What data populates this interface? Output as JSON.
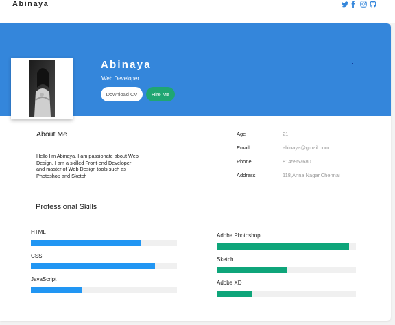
{
  "header": {
    "brand": "Abinaya",
    "social_icons": [
      "twitter-icon",
      "facebook-icon",
      "instagram-icon",
      "github-icon"
    ]
  },
  "profile": {
    "name": "Abinaya",
    "role": "Web Developer",
    "download_cv_label": "Download CV",
    "hire_me_label": "Hire Me"
  },
  "about": {
    "title": "About Me",
    "text": "Hello I'm Abinaya. I am passionate about Web Design. I am a skilled Front-end Developer and master of Web Design tools such as Photoshop and Sketch"
  },
  "info": [
    {
      "label": "Age",
      "value": "21"
    },
    {
      "label": "Email",
      "value": "abinaya@gmail.com"
    },
    {
      "label": "Phone",
      "value": "8145957680"
    },
    {
      "label": "Address",
      "value": "118,Anna Nagar,Chennai"
    }
  ],
  "skills": {
    "title": "Professional Skills",
    "left": [
      {
        "name": "HTML",
        "level": 0.75
      },
      {
        "name": "CSS",
        "level": 0.85
      },
      {
        "name": "JavaScript",
        "level": 0.35
      }
    ],
    "right": [
      {
        "name": "Adobe Photoshop",
        "level": 0.95
      },
      {
        "name": "Sketch",
        "level": 0.5
      },
      {
        "name": "Adobe XD",
        "level": 0.25
      }
    ]
  },
  "colors": {
    "banner": "#3486db",
    "hire_button": "#1fa672",
    "skill_blue": "#2196f3",
    "skill_green": "#0ea57a"
  }
}
